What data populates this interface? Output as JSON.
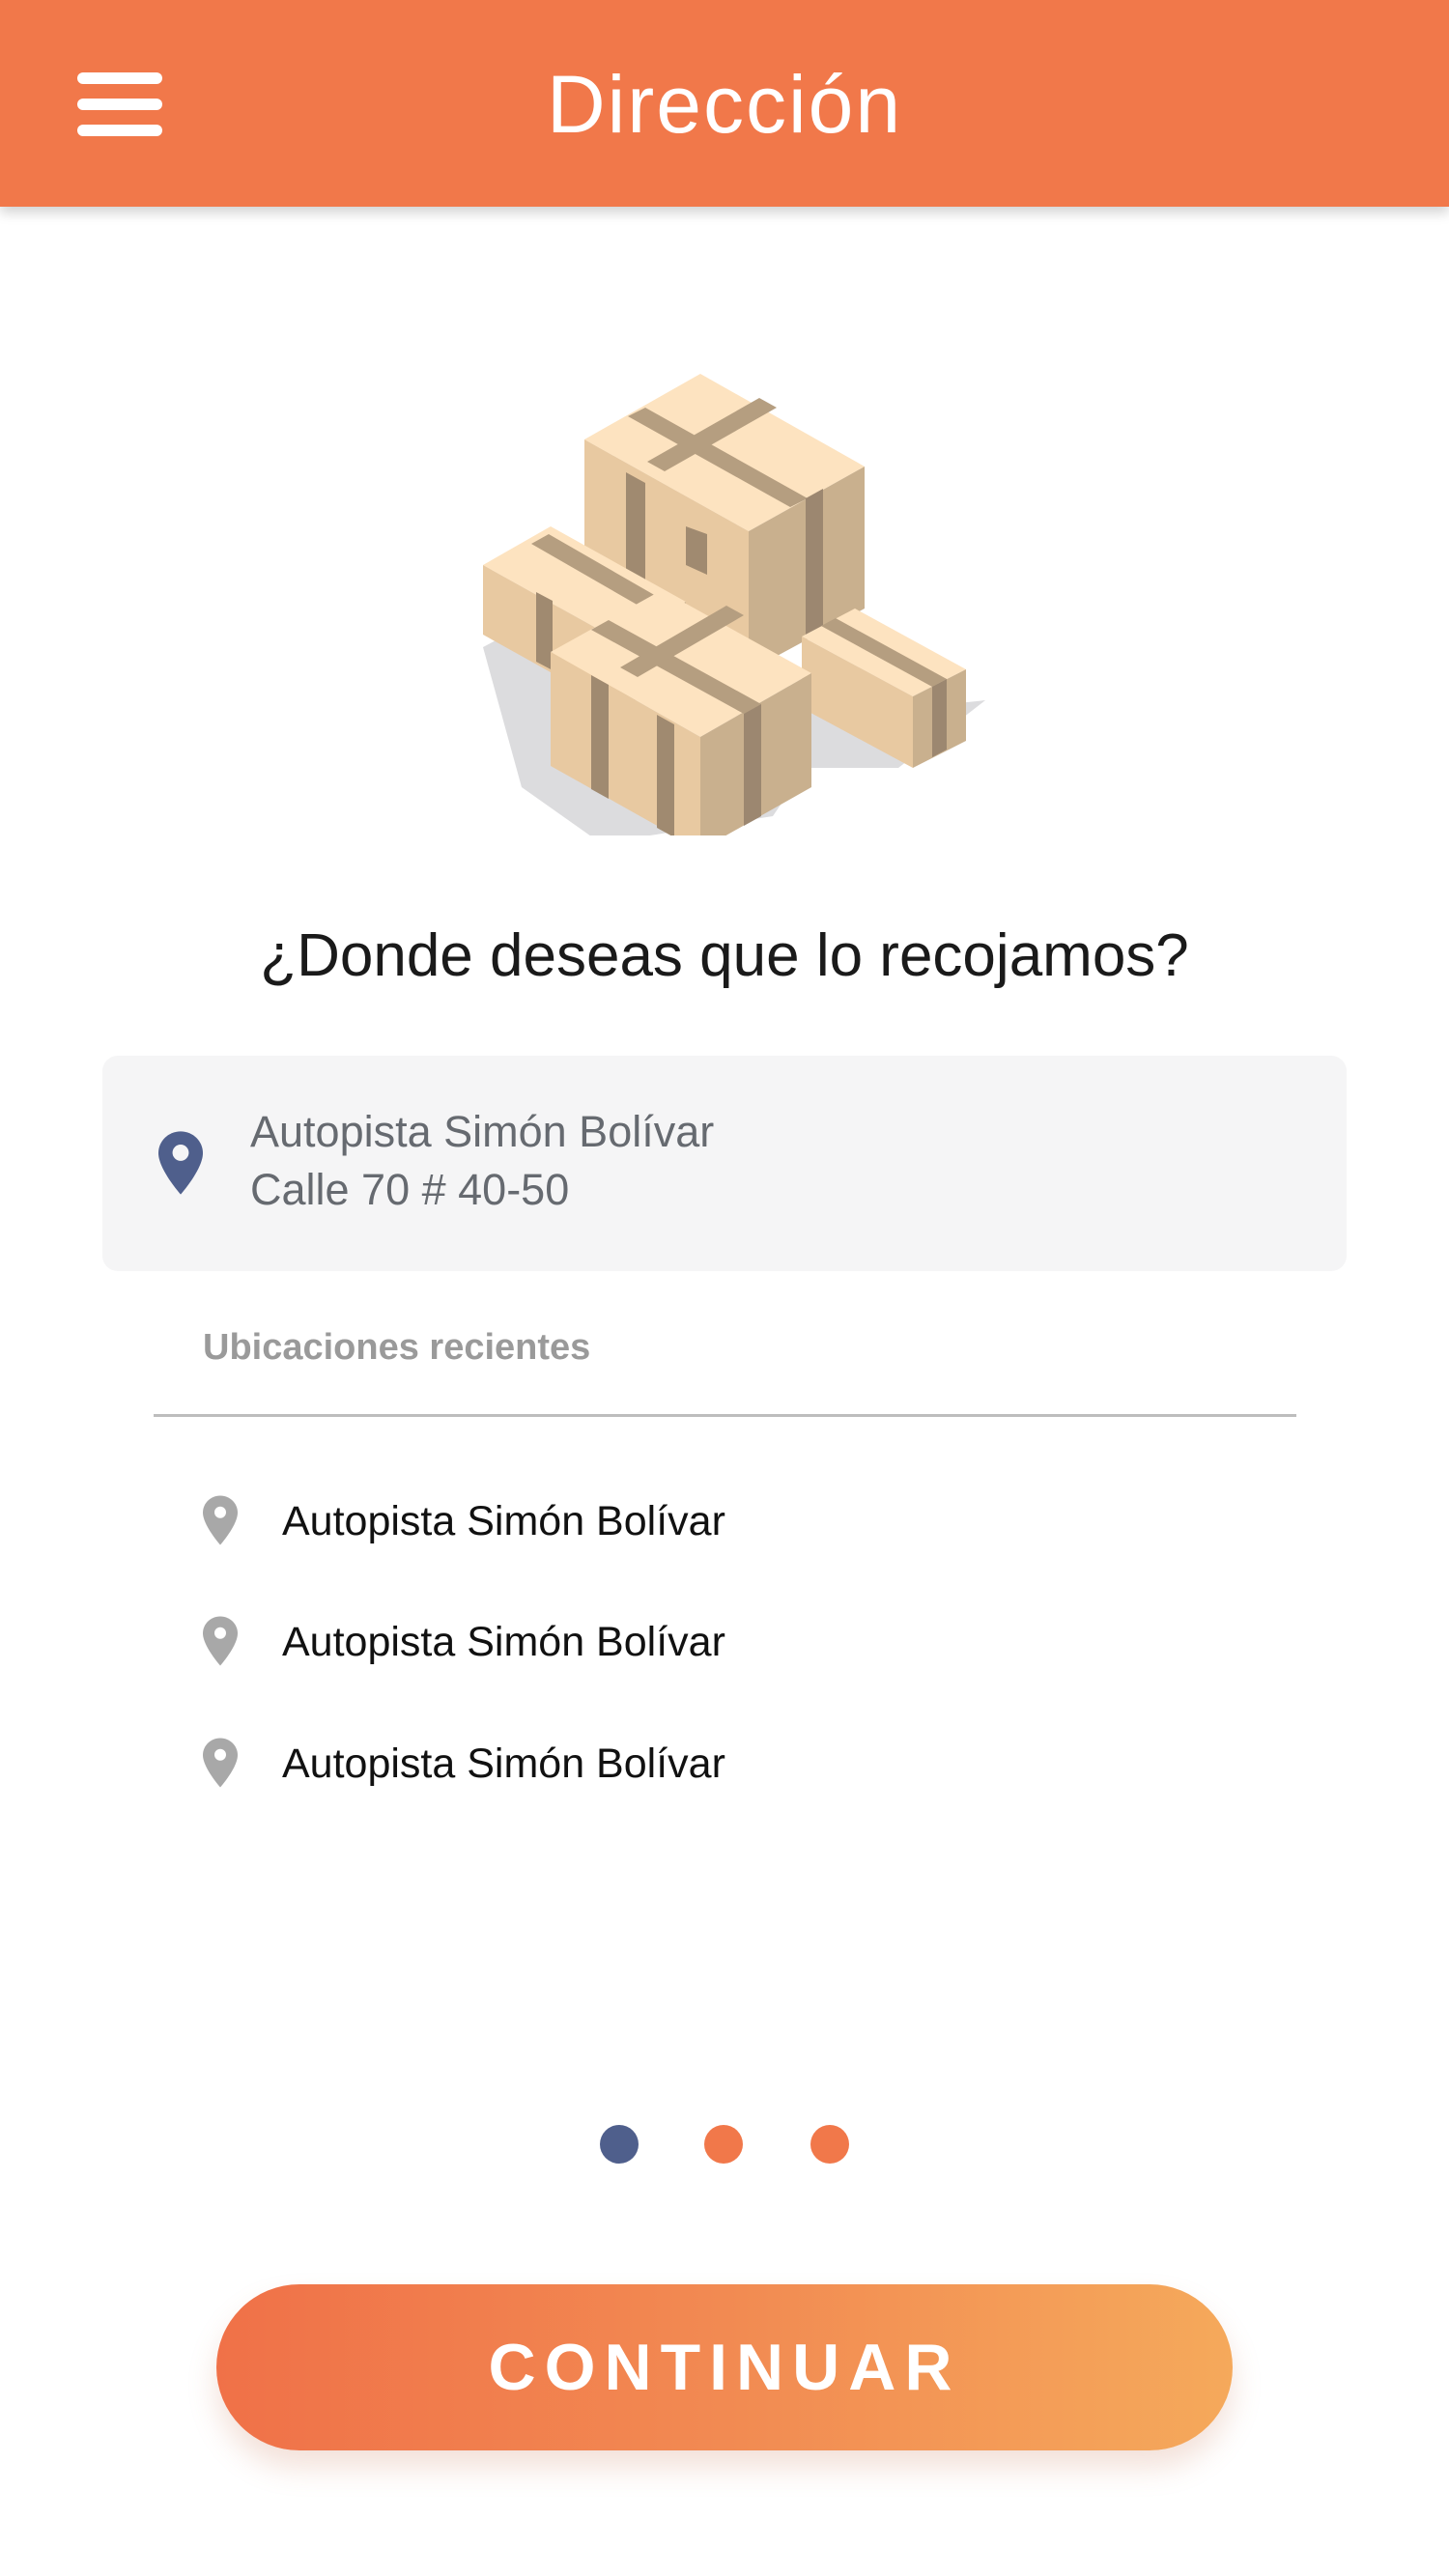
{
  "header": {
    "title": "Dirección",
    "menu_icon": "hamburger-menu-icon",
    "background": "#F1784A"
  },
  "illustration": {
    "icon": "stacked-boxes-illustration"
  },
  "prompt": {
    "question": "¿Donde deseas que lo recojamos?"
  },
  "selected_address": {
    "icon": "location-pin-icon",
    "line1": "Autopista Simón Bolívar",
    "line2": "Calle 70 # 40-50",
    "pin_color": "#4F5F8C"
  },
  "recent": {
    "header": "Ubicaciones recientes",
    "items": [
      {
        "label": "Autopista Simón Bolívar",
        "icon": "location-pin-icon"
      },
      {
        "label": "Autopista Simón Bolívar",
        "icon": "location-pin-icon"
      },
      {
        "label": "Autopista Simón Bolívar",
        "icon": "location-pin-icon"
      }
    ]
  },
  "pagination": {
    "total": 3,
    "active_index": 0,
    "active_color": "#4F5F8C",
    "inactive_color": "#F1784A"
  },
  "cta": {
    "label": "CONTINUAR"
  }
}
